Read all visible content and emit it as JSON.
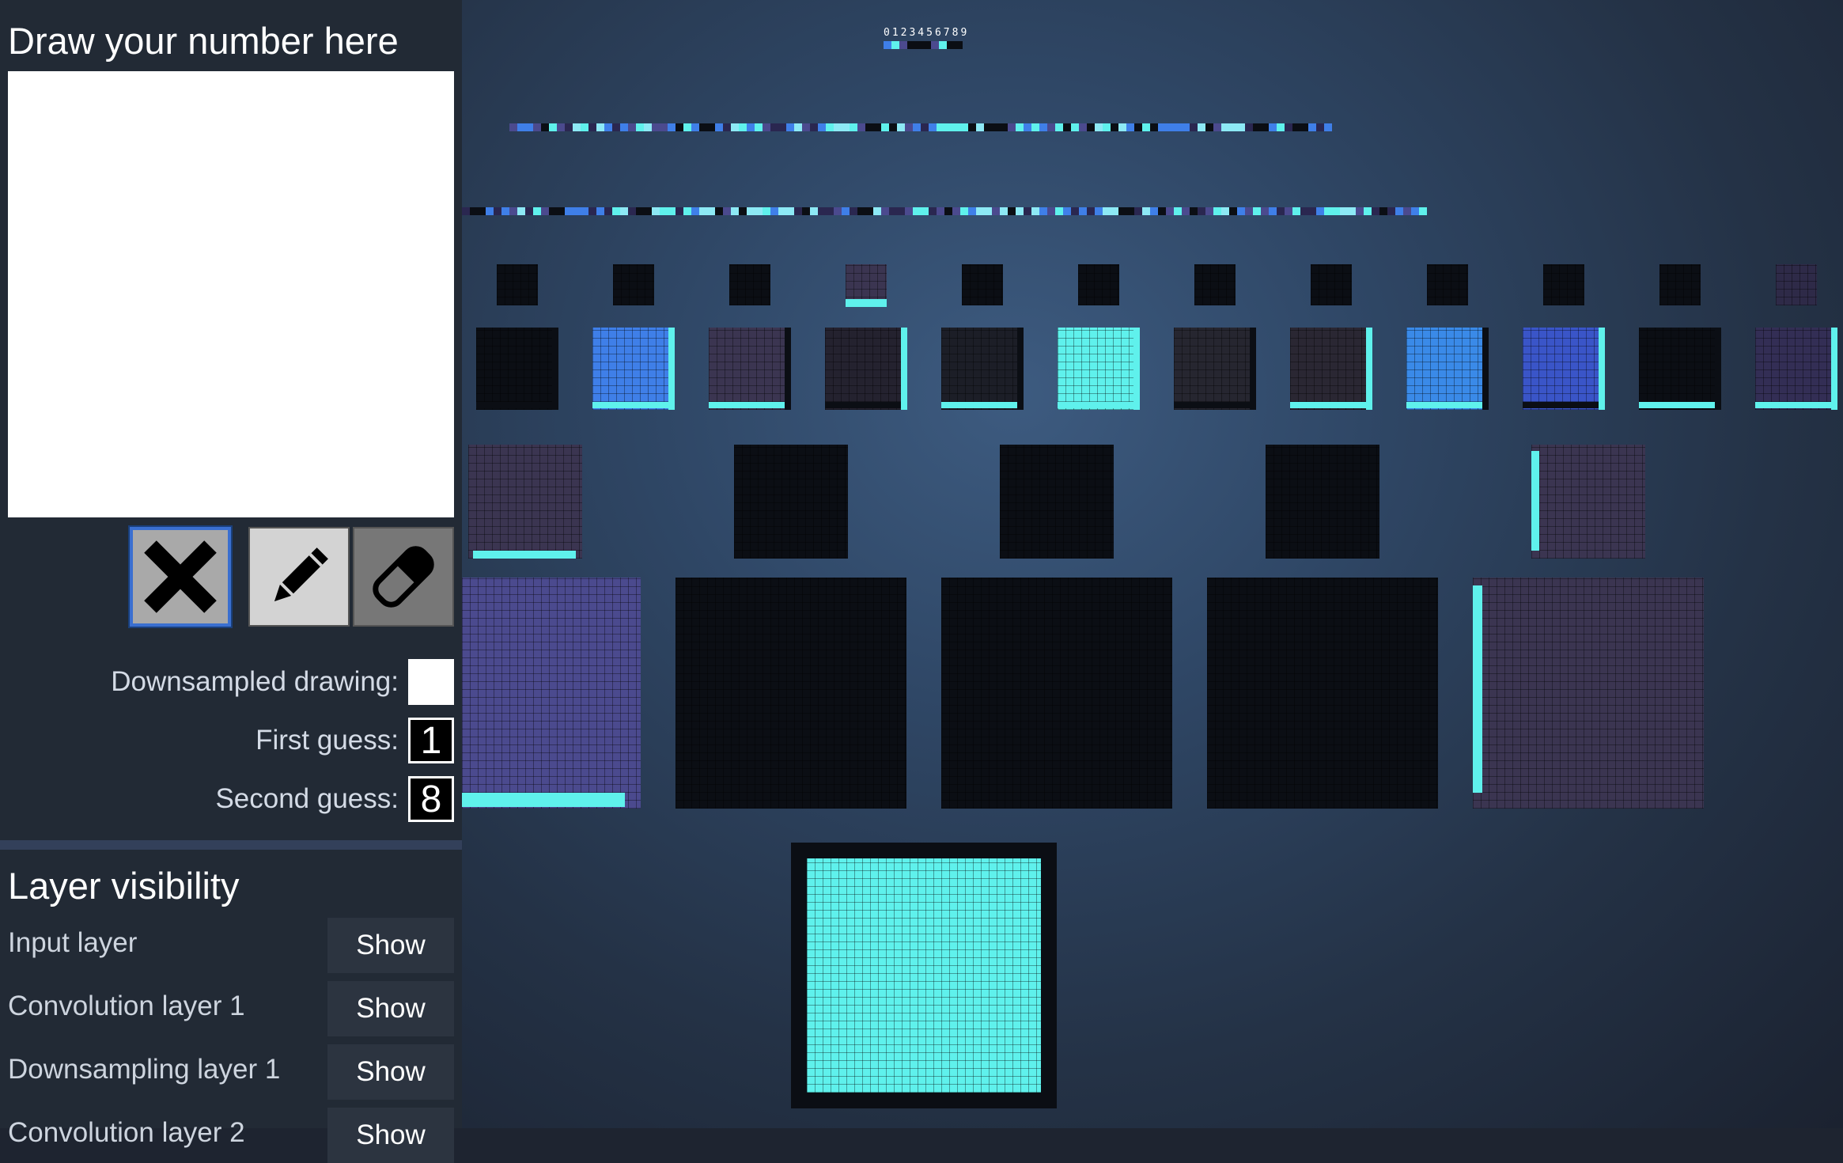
{
  "sidebar": {
    "title": "Draw your number here",
    "tools": {
      "clear": "clear-icon",
      "pencil": "pencil-icon",
      "eraser": "eraser-icon"
    },
    "outputs": {
      "downsampled_label": "Downsampled drawing:",
      "first_guess_label": "First guess:",
      "first_guess_value": "1",
      "second_guess_label": "Second guess:",
      "second_guess_value": "8"
    },
    "layer_visibility": {
      "title": "Layer visibility",
      "layers": [
        {
          "label": "Input layer",
          "button": "Show"
        },
        {
          "label": "Convolution layer 1",
          "button": "Show"
        },
        {
          "label": "Downsampling layer 1",
          "button": "Show"
        },
        {
          "label": "Convolution layer 2",
          "button": "Show"
        }
      ]
    }
  },
  "visualization": {
    "output_digits": "0123456789",
    "colors": {
      "black": "#0b0e14",
      "cyan": "#5ff1ec",
      "blue": "#3f7fe8",
      "violet": "#4b4a8e",
      "muted": "#3b3551",
      "highlight": "#8de9f5"
    }
  }
}
